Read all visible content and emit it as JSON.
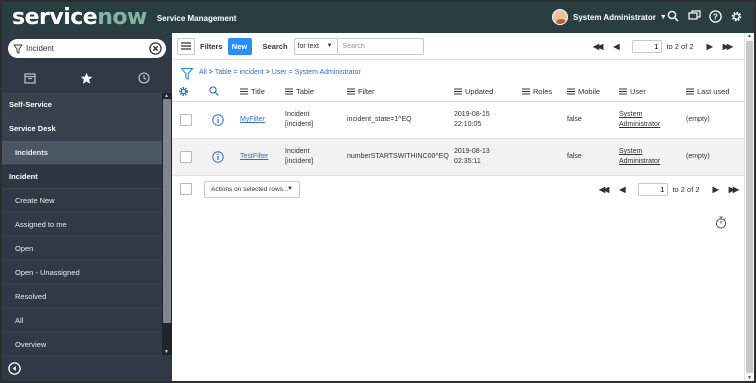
{
  "banner": {
    "logo_service": "service",
    "logo_now": "now",
    "app_title": "Service Management",
    "user_name": "System Administrator",
    "icons": [
      "search-icon",
      "chat-icon",
      "help-icon",
      "gear-icon"
    ]
  },
  "nav": {
    "filter_value": "Incident",
    "tabs": [
      "all-apps-icon",
      "favorites-star-icon",
      "history-clock-icon"
    ],
    "items": [
      {
        "label": "Self-Service",
        "kind": "section"
      },
      {
        "label": "Service Desk",
        "kind": "section"
      },
      {
        "label": "Incidents",
        "kind": "active"
      },
      {
        "label": "Incident",
        "kind": "app"
      },
      {
        "label": "Create New",
        "kind": "sub"
      },
      {
        "label": "Assigned to me",
        "kind": "sub"
      },
      {
        "label": "Open",
        "kind": "sub"
      },
      {
        "label": "Open - Unassigned",
        "kind": "sub"
      },
      {
        "label": "Resolved",
        "kind": "sub"
      },
      {
        "label": "All",
        "kind": "sub"
      },
      {
        "label": "Overview",
        "kind": "sub"
      }
    ]
  },
  "toolbar": {
    "filters_label": "Filters",
    "new_label": "New",
    "search_label": "Search",
    "search_field": "for text",
    "search_placeholder": "Search",
    "page_value": "1",
    "page_of": "to 2 of 2"
  },
  "breadcrumb": {
    "all": "All",
    "sep": ">",
    "parts": [
      "Table = incident",
      "User = System Administrator"
    ]
  },
  "table": {
    "columns": [
      "Title",
      "Table",
      "Filter",
      "Updated",
      "Roles",
      "Mobile",
      "User",
      "Last used"
    ],
    "rows": [
      {
        "title": "MyFilter",
        "table_line1": "Incident",
        "table_line2": "[incident]",
        "filter": "incident_state=1^EQ",
        "updated_line1": "2019-08-15",
        "updated_line2": "22:10:05",
        "roles": "",
        "mobile": "false",
        "user_line1": "System",
        "user_line2": "Administrator",
        "last_used": "(empty)"
      },
      {
        "title": "TestFilter",
        "table_line1": "Incident",
        "table_line2": "[incident]",
        "filter": "numberSTARTSWITHINC00^EQ",
        "updated_line1": "2019-08-13",
        "updated_line2": "02:35:11",
        "roles": "",
        "mobile": "false",
        "user_line1": "System",
        "user_line2": "Administrator",
        "last_used": "(empty)"
      }
    ]
  },
  "footer": {
    "actions_label": "Actions on selected rows...",
    "page_value": "1",
    "page_of": "to 2 of 2"
  },
  "colors": {
    "banner_bg": "#293e40",
    "nav_bg": "#303a46",
    "new_button": "#278efc",
    "link": "#2f6ec2"
  }
}
